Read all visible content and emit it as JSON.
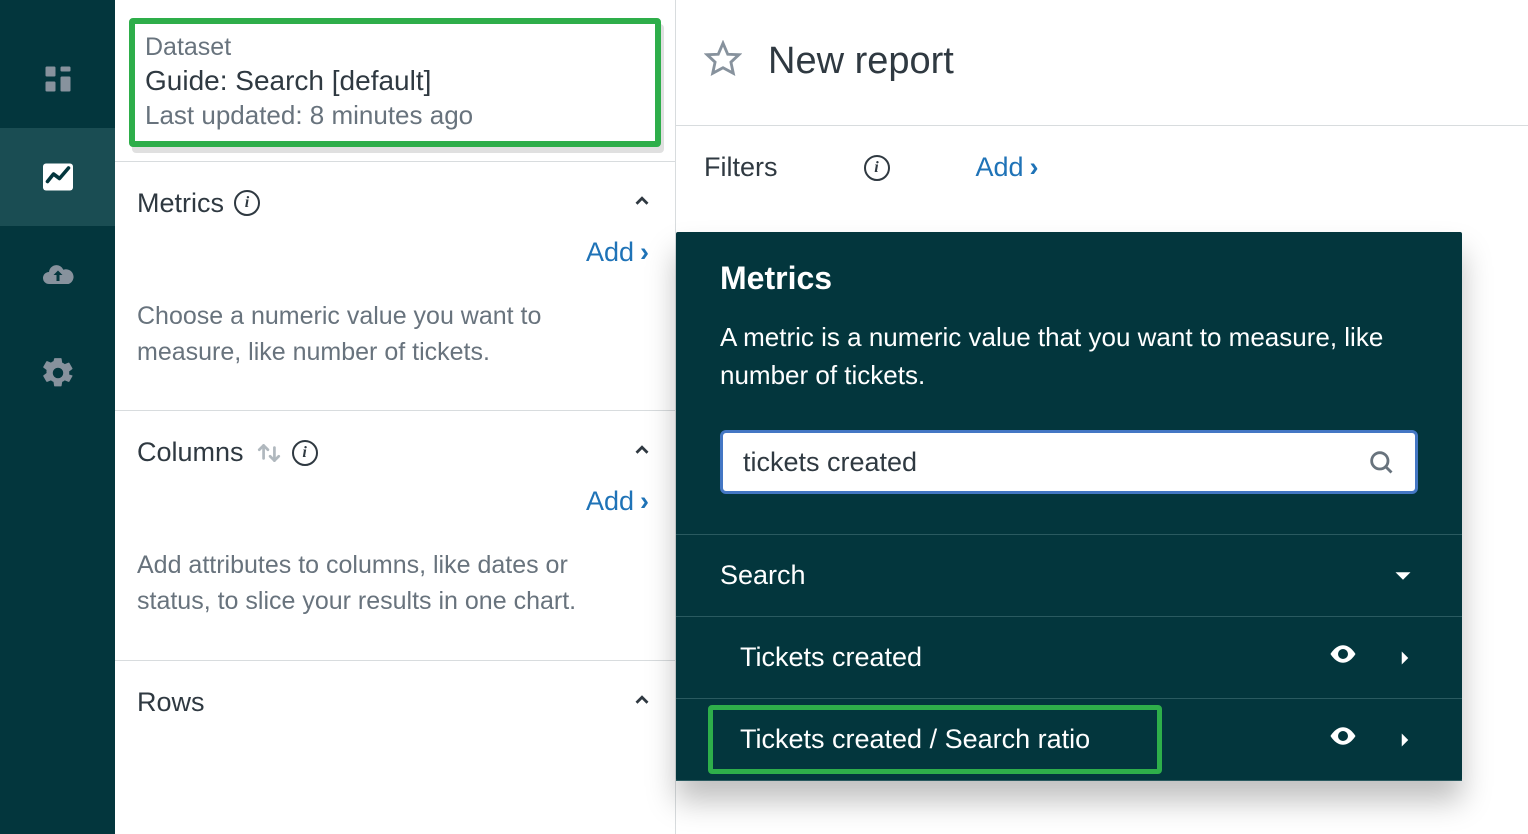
{
  "nav": {
    "items": [
      "dashboard",
      "reports",
      "upload",
      "settings"
    ],
    "active": "reports"
  },
  "dataset": {
    "label": "Dataset",
    "title": "Guide: Search [default]",
    "last_updated": "Last updated: 8 minutes ago"
  },
  "sections": {
    "metrics": {
      "title": "Metrics",
      "add_label": "Add",
      "desc": "Choose a numeric value you want to measure, like number of tickets."
    },
    "columns": {
      "title": "Columns",
      "add_label": "Add",
      "desc": "Add attributes to columns, like dates or status, to slice your results in one chart."
    },
    "rows": {
      "title": "Rows"
    }
  },
  "main": {
    "report_title": "New report",
    "filters_label": "Filters",
    "filters_add": "Add"
  },
  "popover": {
    "title": "Metrics",
    "desc": "A metric is a numeric value that you want to measure, like number of tickets.",
    "search_value": "tickets created",
    "group_label": "Search",
    "results": [
      "Tickets created",
      "Tickets created / Search ratio"
    ]
  }
}
